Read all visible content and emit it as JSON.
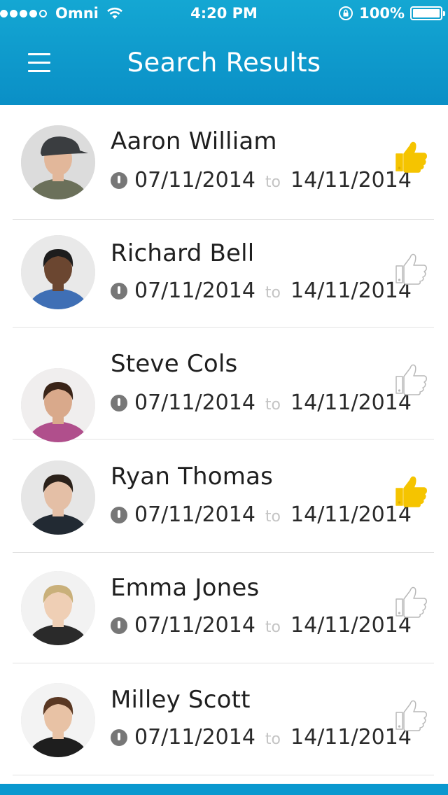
{
  "status_bar": {
    "carrier": "Omni",
    "time": "4:20 PM",
    "battery": "100%",
    "signal_bars_filled": 4,
    "signal_bars_total": 5
  },
  "header": {
    "title": "Search Results",
    "menu_icon": "hamburger-menu-icon",
    "background_color": "#0d9bcc"
  },
  "results": [
    {
      "name": "Aaron William",
      "from": "07/11/2014",
      "to_label": "to",
      "to": "14/11/2014",
      "liked": true
    },
    {
      "name": "Richard Bell",
      "from": "07/11/2014",
      "to_label": "to",
      "to": "14/11/2014",
      "liked": false
    },
    {
      "name": "Steve Cols",
      "from": "07/11/2014",
      "to_label": "to",
      "to": "14/11/2014",
      "liked": false
    },
    {
      "name": "Ryan Thomas",
      "from": "07/11/2014",
      "to_label": "to",
      "to": "14/11/2014",
      "liked": true
    },
    {
      "name": "Emma Jones",
      "from": "07/11/2014",
      "to_label": "to",
      "to": "14/11/2014",
      "liked": false
    },
    {
      "name": "Milley Scott",
      "from": "07/11/2014",
      "to_label": "to",
      "to": "14/11/2014",
      "liked": false
    }
  ],
  "colors": {
    "accent": "#0d9bcc",
    "liked_thumb": "#f5c400",
    "unliked_thumb_outline": "#b9b9b9"
  }
}
